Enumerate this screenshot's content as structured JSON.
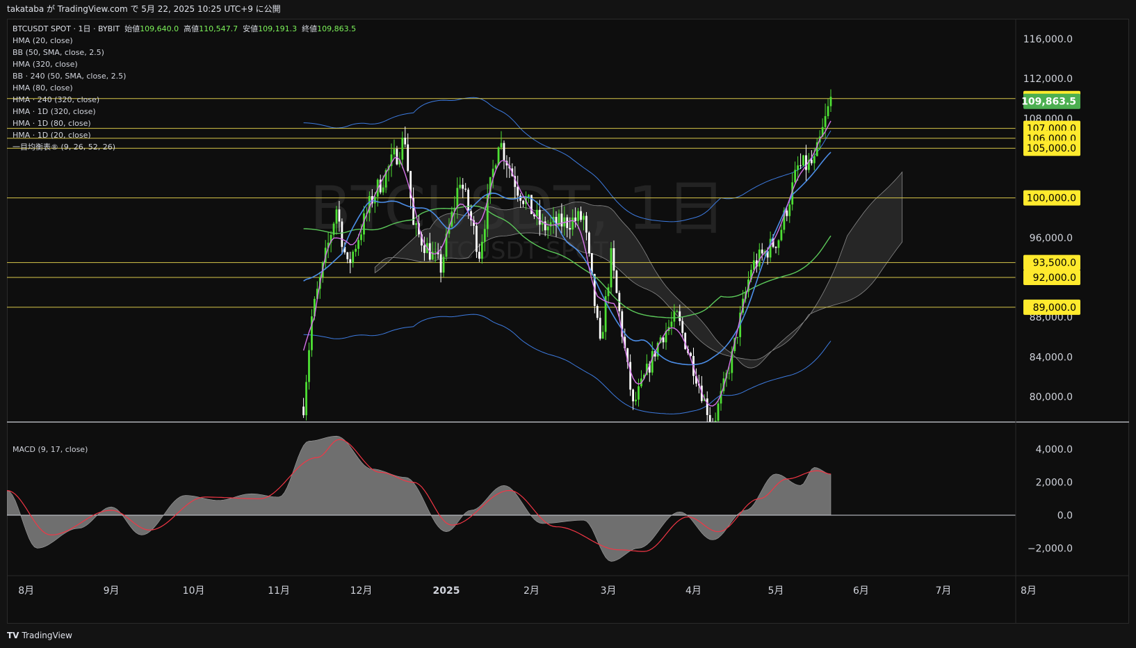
{
  "header": {
    "text": "takataba が TradingView.com で 5月 22, 2025 10:25 UTC+9 に公開"
  },
  "legend": {
    "symbol": "BTCUSDT SPOT · 1日 · BYBIT",
    "open_label": "始値",
    "open": "109,640.0",
    "high_label": "高値",
    "high": "110,547.7",
    "low_label": "安値",
    "low": "109,191.3",
    "close_label": "終値",
    "close": "109,863.5",
    "indicators": [
      "HMA (20, close)",
      "BB (50, SMA, close, 2.5)",
      "HMA (320, close)",
      "BB · 240 (50, SMA, close, 2.5)",
      "HMA (80, close)",
      "HMA · 240 (320, close)",
      "HMA · 1D (320, close)",
      "HMA · 1D (80, close)",
      "HMA · 1D (20, close)",
      "一目均衡表® (9, 26, 52, 26)"
    ]
  },
  "watermark": {
    "main": "BTCUSDT, 1日",
    "sub": "BTCUSDT SPOT"
  },
  "macd": {
    "label": "MACD (9, 17, close)"
  },
  "footer": {
    "brand": "TradingView"
  },
  "colors": {
    "background": "#0e0e0e",
    "up": "#4ee034",
    "down": "#ffffff",
    "hma20": "#d472e8",
    "hma80": "#4c8ee8",
    "hma320": "#5cc95a",
    "bb": "#3d7be0",
    "level_line": "#d9c84a",
    "level_badge": "#ffea2d",
    "price_badge": "#4caf50",
    "macd_signal": "#f23645",
    "macd_hist": "#808080"
  },
  "chart_data": [
    {
      "type": "candlestick",
      "title": "BTCUSDT, 1日",
      "y_axis_ticks": [
        80000,
        84000,
        88000,
        96000,
        108000,
        112000,
        116000
      ],
      "x_axis_ticks": [
        "8月",
        "9月",
        "10月",
        "11月",
        "12月",
        "2025",
        "2月",
        "3月",
        "4月",
        "5月",
        "6月",
        "7月",
        "8月"
      ],
      "current_price": 109863.5,
      "current_price_label": "109,863.5",
      "horizontal_levels": [
        {
          "value": 110000,
          "label": "110,000.0"
        },
        {
          "value": 107000,
          "label": "107,000.0"
        },
        {
          "value": 106000,
          "label": "106,000.0"
        },
        {
          "value": 105000,
          "label": "105,000.0"
        },
        {
          "value": 100000,
          "label": "100,000.0"
        },
        {
          "value": 93500,
          "label": "93,500.0"
        },
        {
          "value": 92000,
          "label": "92,000.0"
        },
        {
          "value": 89000,
          "label": "89,000.0"
        }
      ],
      "close_path": [
        {
          "date": "2024-11-10",
          "close": 79000
        },
        {
          "date": "2024-11-13",
          "close": 88000
        },
        {
          "date": "2024-11-22",
          "close": 99000
        },
        {
          "date": "2024-11-26",
          "close": 93000
        },
        {
          "date": "2024-12-05",
          "close": 100000
        },
        {
          "date": "2024-12-17",
          "close": 106000
        },
        {
          "date": "2024-12-20",
          "close": 97000
        },
        {
          "date": "2024-12-30",
          "close": 93000
        },
        {
          "date": "2025-01-06",
          "close": 102000
        },
        {
          "date": "2025-01-13",
          "close": 94500
        },
        {
          "date": "2025-01-20",
          "close": 106000
        },
        {
          "date": "2025-01-27",
          "close": 101000
        },
        {
          "date": "2025-02-05",
          "close": 97000
        },
        {
          "date": "2025-02-20",
          "close": 98000
        },
        {
          "date": "2025-02-26",
          "close": 85000
        },
        {
          "date": "2025-03-02",
          "close": 94000
        },
        {
          "date": "2025-03-10",
          "close": 79000
        },
        {
          "date": "2025-03-20",
          "close": 86000
        },
        {
          "date": "2025-03-26",
          "close": 88000
        },
        {
          "date": "2025-04-01",
          "close": 83000
        },
        {
          "date": "2025-04-08",
          "close": 77000
        },
        {
          "date": "2025-04-15",
          "close": 84000
        },
        {
          "date": "2025-04-22",
          "close": 93000
        },
        {
          "date": "2025-05-02",
          "close": 96000
        },
        {
          "date": "2025-05-09",
          "close": 103000
        },
        {
          "date": "2025-05-15",
          "close": 103500
        },
        {
          "date": "2025-05-21",
          "close": 109863.5
        }
      ]
    },
    {
      "type": "area",
      "title": "MACD (9, 17, close)",
      "y_axis_ticks": [
        -2000,
        0,
        2000,
        4000
      ],
      "series": [
        {
          "values": [
            {
              "date": "2024-07-25",
              "v": 1500
            },
            {
              "date": "2024-08-05",
              "v": -2000
            },
            {
              "date": "2024-08-20",
              "v": -800
            },
            {
              "date": "2024-09-01",
              "v": 500
            },
            {
              "date": "2024-09-12",
              "v": -1200
            },
            {
              "date": "2024-09-28",
              "v": 1200
            },
            {
              "date": "2024-10-10",
              "v": 900
            },
            {
              "date": "2024-10-22",
              "v": 1300
            },
            {
              "date": "2024-11-01",
              "v": 1100
            },
            {
              "date": "2024-11-12",
              "v": 4500
            },
            {
              "date": "2024-11-22",
              "v": 4800
            },
            {
              "date": "2024-12-05",
              "v": 2800
            },
            {
              "date": "2024-12-17",
              "v": 2300
            },
            {
              "date": "2025-01-01",
              "v": -1000
            },
            {
              "date": "2025-01-10",
              "v": 300
            },
            {
              "date": "2025-01-22",
              "v": 1800
            },
            {
              "date": "2025-02-05",
              "v": -500
            },
            {
              "date": "2025-02-20",
              "v": -300
            },
            {
              "date": "2025-03-02",
              "v": -2800
            },
            {
              "date": "2025-03-12",
              "v": -2000
            },
            {
              "date": "2025-03-27",
              "v": 200
            },
            {
              "date": "2025-04-08",
              "v": -1500
            },
            {
              "date": "2025-04-20",
              "v": 300
            },
            {
              "date": "2025-05-01",
              "v": 2500
            },
            {
              "date": "2025-05-10",
              "v": 1800
            },
            {
              "date": "2025-05-15",
              "v": 2900
            },
            {
              "date": "2025-05-21",
              "v": 2500
            }
          ]
        },
        {
          "values": [
            {
              "date": "2024-07-25",
              "v": 1500
            },
            {
              "date": "2024-08-10",
              "v": -1200
            },
            {
              "date": "2024-09-01",
              "v": 300
            },
            {
              "date": "2024-09-15",
              "v": -900
            },
            {
              "date": "2024-10-05",
              "v": 1100
            },
            {
              "date": "2024-10-25",
              "v": 1000
            },
            {
              "date": "2024-11-15",
              "v": 3500
            },
            {
              "date": "2024-11-23",
              "v": 4600
            },
            {
              "date": "2024-12-08",
              "v": 2600
            },
            {
              "date": "2024-12-20",
              "v": 2000
            },
            {
              "date": "2025-01-03",
              "v": -600
            },
            {
              "date": "2025-01-24",
              "v": 1500
            },
            {
              "date": "2025-02-10",
              "v": -700
            },
            {
              "date": "2025-03-05",
              "v": -2100
            },
            {
              "date": "2025-03-14",
              "v": -2200
            },
            {
              "date": "2025-03-30",
              "v": -100
            },
            {
              "date": "2025-04-10",
              "v": -1000
            },
            {
              "date": "2025-04-25",
              "v": 1000
            },
            {
              "date": "2025-05-05",
              "v": 2200
            },
            {
              "date": "2025-05-16",
              "v": 2700
            },
            {
              "date": "2025-05-21",
              "v": 2500
            }
          ]
        }
      ]
    }
  ]
}
